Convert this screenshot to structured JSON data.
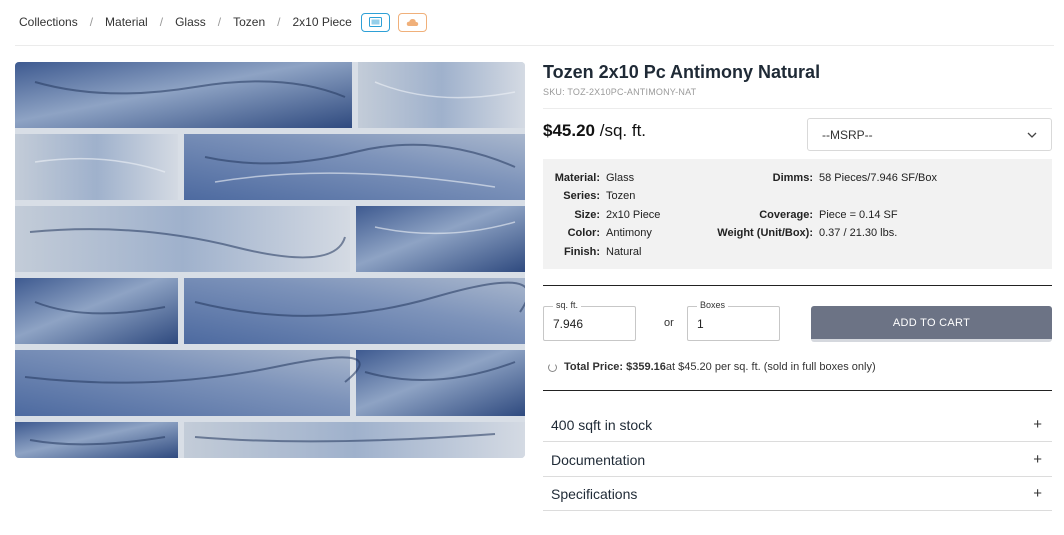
{
  "breadcrumb": {
    "items": [
      "Collections",
      "Material",
      "Glass",
      "Tozen",
      "2x10 Piece"
    ],
    "separator": "/",
    "gallery_icon": "gallery-icon",
    "cloud_icon": "cloud-icon"
  },
  "product": {
    "title": "Tozen 2x10 Pc Antimony Natural",
    "sku": "SKU: TOZ-2X10PC-ANTIMONY-NAT",
    "price": "$45.20",
    "price_unit": " /sq. ft.",
    "msrp_select": "--MSRP--"
  },
  "specs": {
    "material_label": "Material:",
    "material": "Glass",
    "series_label": "Series:",
    "series": "Tozen",
    "size_label": "Size:",
    "size": "2x10 Piece",
    "color_label": "Color:",
    "color": "Antimony",
    "finish_label": "Finish:",
    "finish": "Natural",
    "dimms_label": "Dimms:",
    "dimms": "58 Pieces/7.946 SF/Box",
    "coverage_label": "Coverage:",
    "coverage": "Piece = 0.14 SF",
    "weight_label": "Weight (Unit/Box):",
    "weight": "0.37 / 21.30 lbs."
  },
  "order": {
    "sqft_legend": "sq. ft.",
    "sqft_value": "7.946",
    "or_text": "or",
    "boxes_legend": "Boxes",
    "boxes_value": "1",
    "add_to_cart": "ADD TO CART",
    "total_label": "Total Price: $359.16",
    "total_detail": " at $45.20 per sq. ft. (sold in full boxes only)"
  },
  "accordions": [
    {
      "label": "400 sqft in stock",
      "icon": "+"
    },
    {
      "label": "Documentation",
      "icon": "+"
    },
    {
      "label": "Specifications",
      "icon": "+"
    }
  ],
  "colors": {
    "accent_blue": "#2ea0d6",
    "accent_orange": "#f0b07a",
    "cart_button": "#6c7385",
    "tile_dark_blue": "#3f5b8e",
    "tile_light": "#c9d3de"
  }
}
